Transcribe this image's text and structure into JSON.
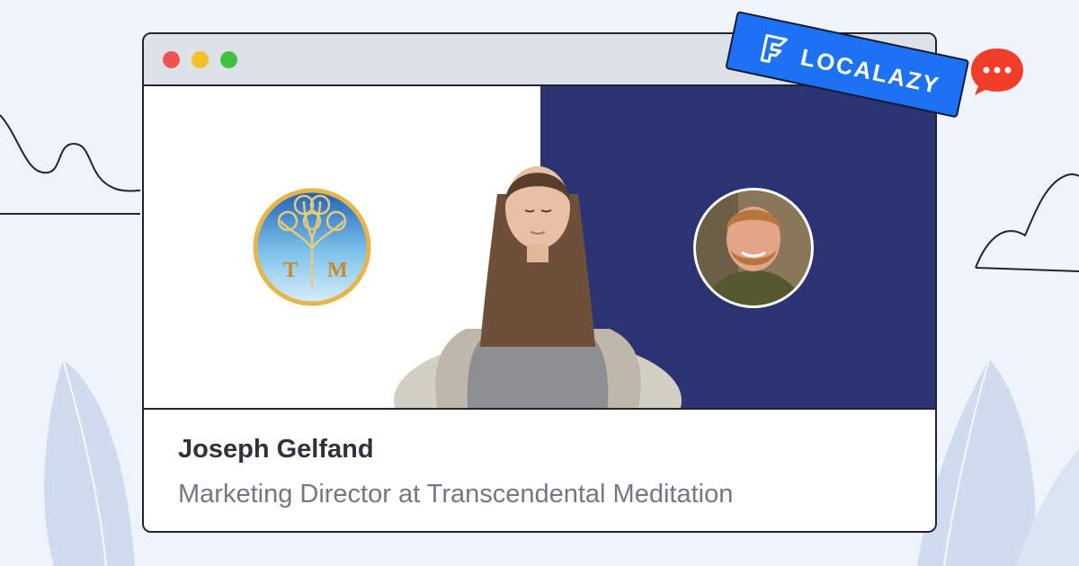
{
  "brand": {
    "name": "LOCALAZY",
    "accent_color": "#1d72f3",
    "chat_bubble_color": "#f23d2a"
  },
  "window": {
    "controls": [
      "close",
      "minimize",
      "maximize"
    ],
    "titlebar_color": "#dde2e8"
  },
  "hero": {
    "left_logo": {
      "letters_left": "T",
      "letters_right": "M",
      "icon": "tree-of-life-icon"
    },
    "right_panel_color": "#2b3372",
    "person_center": "meditating-woman-photo",
    "person_avatar": "smiling-man-avatar"
  },
  "caption": {
    "name": "Joseph Gelfand",
    "role": "Marketing Director at Transcendental Meditation"
  }
}
